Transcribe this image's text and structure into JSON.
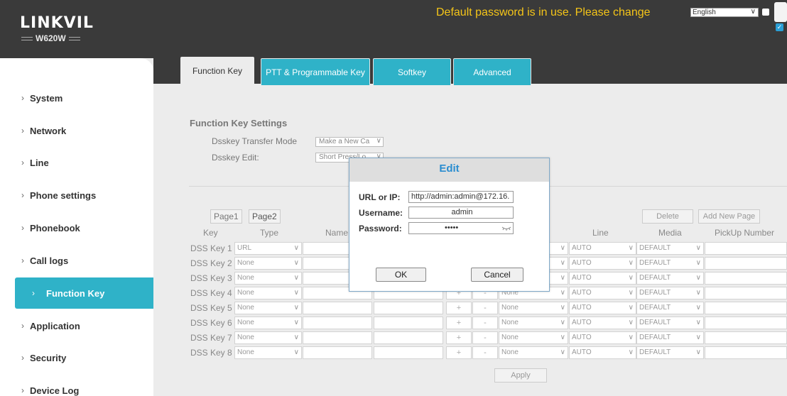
{
  "brand": {
    "logo": "LINKVIL",
    "model": "W620W"
  },
  "header": {
    "warning": "Default password is in use. Please change",
    "language": "English"
  },
  "sidebar": {
    "items": [
      {
        "label": "System"
      },
      {
        "label": "Network"
      },
      {
        "label": "Line"
      },
      {
        "label": "Phone settings"
      },
      {
        "label": "Phonebook"
      },
      {
        "label": "Call logs"
      },
      {
        "label": "Function Key",
        "active": true
      },
      {
        "label": "Application"
      },
      {
        "label": "Security"
      },
      {
        "label": "Device Log"
      }
    ]
  },
  "tabs": [
    {
      "label": "Function Key",
      "active": true
    },
    {
      "label": "PTT & Programmable Key"
    },
    {
      "label": "Softkey"
    },
    {
      "label": "Advanced"
    }
  ],
  "settings": {
    "title": "Function Key Settings",
    "transfer_mode_label": "Dsskey Transfer Mode",
    "transfer_mode_value": "Make a New Ca",
    "edit_label": "Dsskey Edit:",
    "edit_value": "Short Press/Lo"
  },
  "pager": {
    "page1": "Page1",
    "page2": "Page2",
    "delete": "Delete",
    "add_new_page": "Add New Page"
  },
  "table": {
    "columns": {
      "key": "Key",
      "type": "Type",
      "name": "Name",
      "line": "Line",
      "media": "Media",
      "pickup": "PickUp Number"
    },
    "rows": [
      {
        "key": "DSS Key 1",
        "type": "URL",
        "value": "None",
        "line": "AUTO",
        "media": "DEFAULT"
      },
      {
        "key": "DSS Key 2",
        "type": "None",
        "value": "None",
        "line": "AUTO",
        "media": "DEFAULT"
      },
      {
        "key": "DSS Key 3",
        "type": "None",
        "value": "None",
        "line": "AUTO",
        "media": "DEFAULT"
      },
      {
        "key": "DSS Key 4",
        "type": "None",
        "value": "None",
        "line": "AUTO",
        "media": "DEFAULT"
      },
      {
        "key": "DSS Key 5",
        "type": "None",
        "value": "None",
        "line": "AUTO",
        "media": "DEFAULT"
      },
      {
        "key": "DSS Key 6",
        "type": "None",
        "value": "None",
        "line": "AUTO",
        "media": "DEFAULT"
      },
      {
        "key": "DSS Key 7",
        "type": "None",
        "value": "None",
        "line": "AUTO",
        "media": "DEFAULT"
      },
      {
        "key": "DSS Key 8",
        "type": "None",
        "value": "None",
        "line": "AUTO",
        "media": "DEFAULT"
      }
    ],
    "plus": "+",
    "minus": "-"
  },
  "apply_label": "Apply",
  "modal": {
    "title": "Edit",
    "url_label": "URL or IP:",
    "url_value": "http://admin:admin@172.16.",
    "username_label": "Username:",
    "username_value": "admin",
    "password_label": "Password:",
    "password_value": "•••••",
    "ok_label": "OK",
    "cancel_label": "Cancel"
  },
  "icons": {
    "eye": "eye-closed-icon",
    "chevron": "chevron-down-icon",
    "arrow": "chevron-right-icon"
  },
  "colors": {
    "accent": "#2fb2c8",
    "header_bg": "#3a3a3a",
    "warning": "#f5c518",
    "modal_title": "#2a8dd0"
  }
}
